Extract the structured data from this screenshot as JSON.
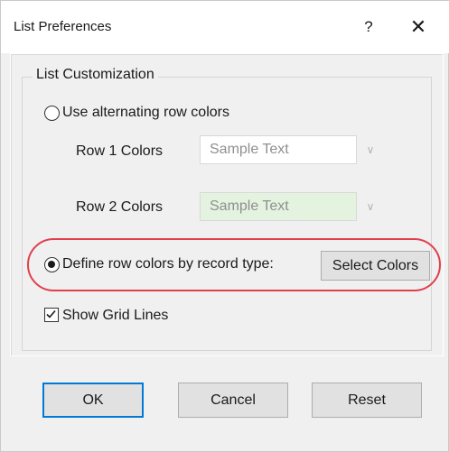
{
  "window": {
    "title": "List Preferences",
    "help_glyph": "?",
    "close_glyph": "✕"
  },
  "group": {
    "legend": "List Customization"
  },
  "alternating": {
    "label": "Use alternating row colors",
    "selected": false
  },
  "row1": {
    "label": "Row 1 Colors",
    "sample_text": "Sample Text",
    "background": "#ffffff",
    "chevron": "∨"
  },
  "row2": {
    "label": "Row 2 Colors",
    "sample_text": "Sample Text",
    "background": "#e4f3df",
    "chevron": "∨"
  },
  "by_record_type": {
    "label": "Define row colors by record type:",
    "selected": true,
    "button_label": "Select Colors"
  },
  "grid_lines": {
    "label": "Show Grid Lines",
    "checked": true
  },
  "buttons": {
    "ok": "OK",
    "cancel": "Cancel",
    "reset": "Reset"
  },
  "colors": {
    "highlight": "#e0404c",
    "default_button_border": "#0078d7"
  }
}
